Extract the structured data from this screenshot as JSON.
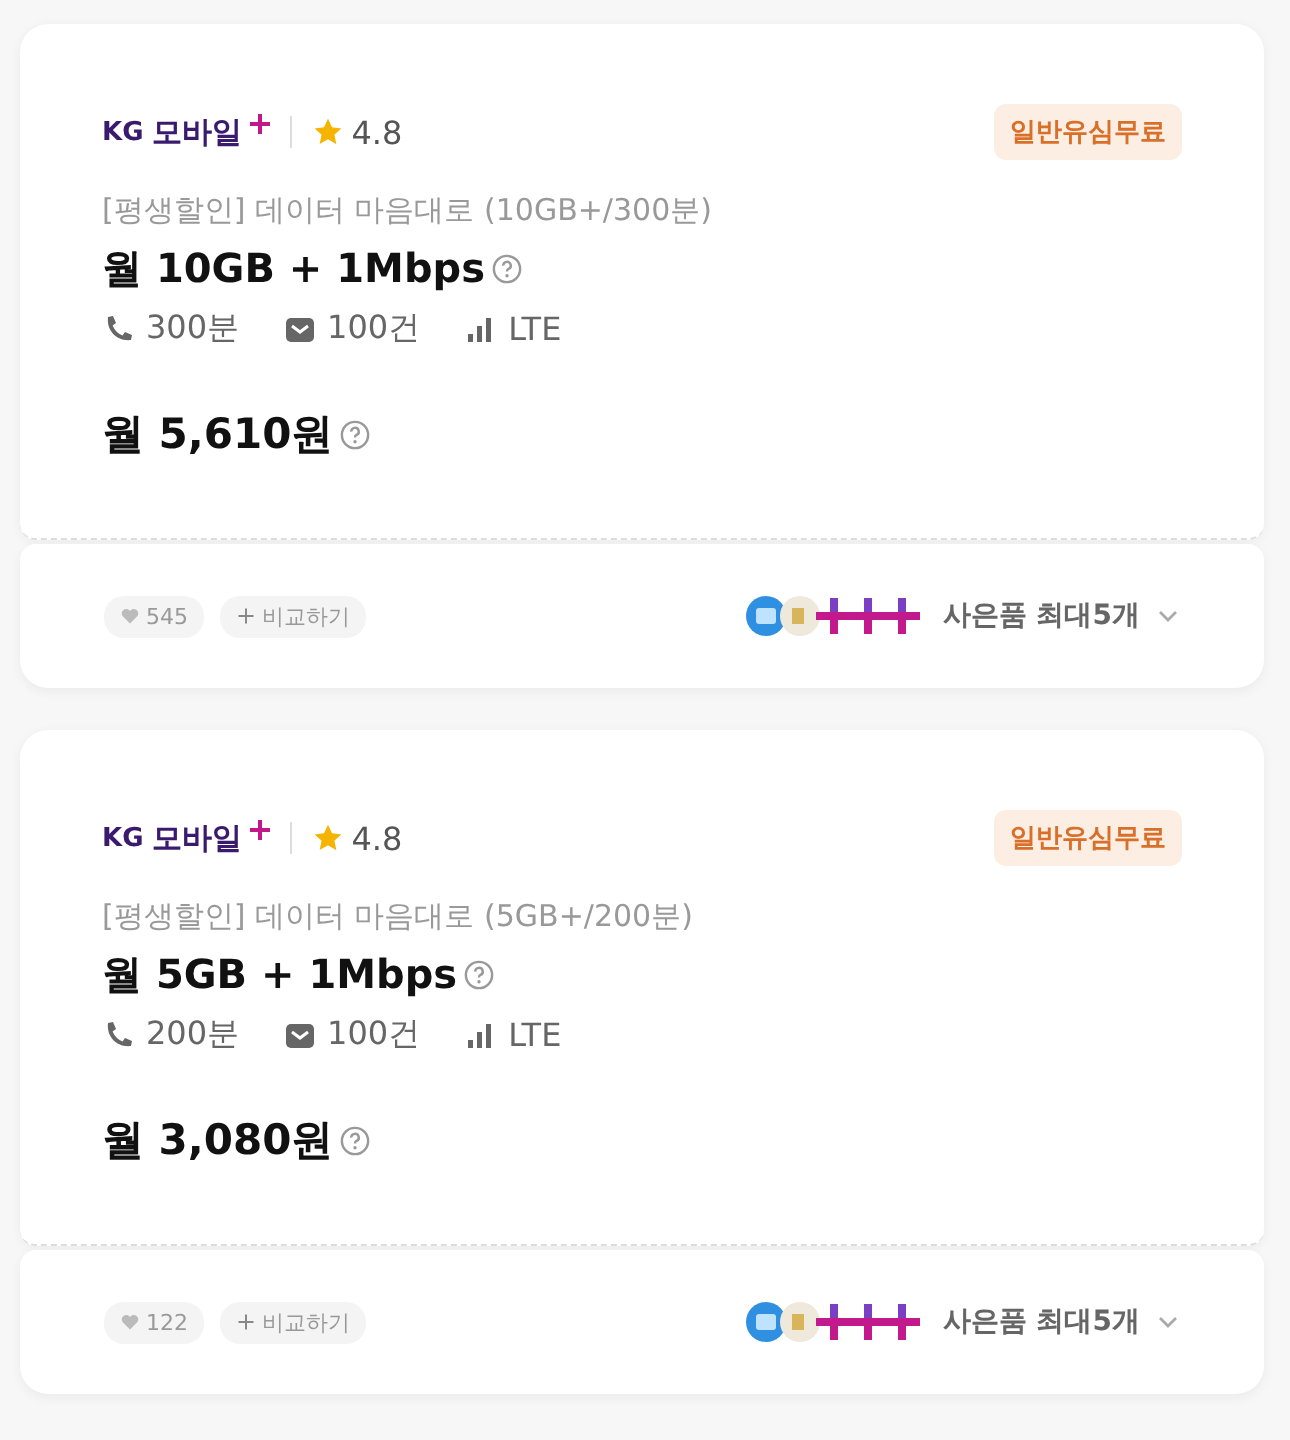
{
  "plans": [
    {
      "brand": {
        "prefix": "KG",
        "name": "모바일"
      },
      "rating": "4.8",
      "badge": "일반유심무료",
      "subtitle": "[평생할인] 데이터 마음대로 (10GB+/300분)",
      "title": "월 10GB + 1Mbps",
      "specs": [
        {
          "kind": "call",
          "text": "300분"
        },
        {
          "kind": "sms",
          "text": "100건"
        },
        {
          "kind": "network",
          "text": "LTE"
        }
      ],
      "price": "월 5,610원",
      "likes": "545",
      "compare": "비교하기",
      "gifts": "사은품 최대5개"
    },
    {
      "brand": {
        "prefix": "KG",
        "name": "모바일"
      },
      "rating": "4.8",
      "badge": "일반유심무료",
      "subtitle": "[평생할인] 데이터 마음대로 (5GB+/200분)",
      "title": "월 5GB + 1Mbps",
      "specs": [
        {
          "kind": "call",
          "text": "200분"
        },
        {
          "kind": "sms",
          "text": "100건"
        },
        {
          "kind": "network",
          "text": "LTE"
        }
      ],
      "price": "월 3,080원",
      "likes": "122",
      "compare": "비교하기",
      "gifts": "사은품 최대5개"
    }
  ]
}
